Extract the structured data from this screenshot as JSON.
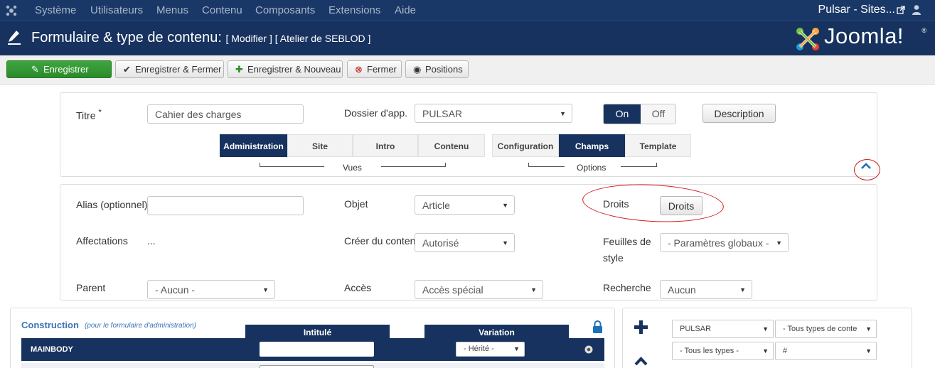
{
  "menubar": {
    "items": [
      "Système",
      "Utilisateurs",
      "Menus",
      "Contenu",
      "Composants",
      "Extensions",
      "Aide"
    ],
    "site_link": "Pulsar - Sites..."
  },
  "header": {
    "title": "Formulaire & type de contenu:",
    "subtitle": "[ Modifier ] [ Atelier de SEBLOD ]",
    "brand": "Joomla!",
    "brand_mark": "®"
  },
  "toolbar": {
    "save": "Enregistrer",
    "save_close": "Enregistrer & Fermer",
    "save_new": "Enregistrer & Nouveau",
    "close": "Fermer",
    "positions": "Positions"
  },
  "top_form": {
    "title_label": "Titre",
    "required_mark": "*",
    "title_value": "Cahier des charges",
    "folder_label": "Dossier d'app.",
    "folder_value": "PULSAR",
    "on_label": "On",
    "off_label": "Off",
    "description_button": "Description",
    "views_tabs": [
      "Administration",
      "Site",
      "Intro",
      "Contenu"
    ],
    "views_caption": "Vues",
    "options_tabs": [
      "Configuration",
      "Champs",
      "Template"
    ],
    "options_caption": "Options"
  },
  "detail_form": {
    "alias_label": "Alias (optionnel)",
    "alias_value": "",
    "object_label": "Objet",
    "object_value": "Article",
    "rights_label": "Droits",
    "rights_button": "Droits",
    "assign_label": "Affectations",
    "assign_value": "...",
    "create_label": "Créer du contenu",
    "create_value": "Autorisé",
    "stylesheets_label": "Feuilles de style",
    "stylesheets_value": "- Paramètres globaux -",
    "parent_label": "Parent",
    "parent_value": "- Aucun -",
    "access_label": "Accès",
    "access_value": "Accès spécial",
    "search_label": "Recherche",
    "search_value": "Aucun"
  },
  "construction": {
    "title": "Construction",
    "note": "(pour le formulaire d'administration)",
    "col_label": "Intitulé",
    "col_variation": "Variation",
    "row_name": "MAINBODY",
    "variation_value": "- Hérité -"
  },
  "filters": {
    "app_value": "PULSAR",
    "content_types": "- Tous types de conte",
    "types": "- Tous les types -",
    "hash": "#"
  },
  "colors": {
    "navy": "#17325f",
    "green": "#2b8a2b",
    "annotation_red": "#d01c1c"
  }
}
